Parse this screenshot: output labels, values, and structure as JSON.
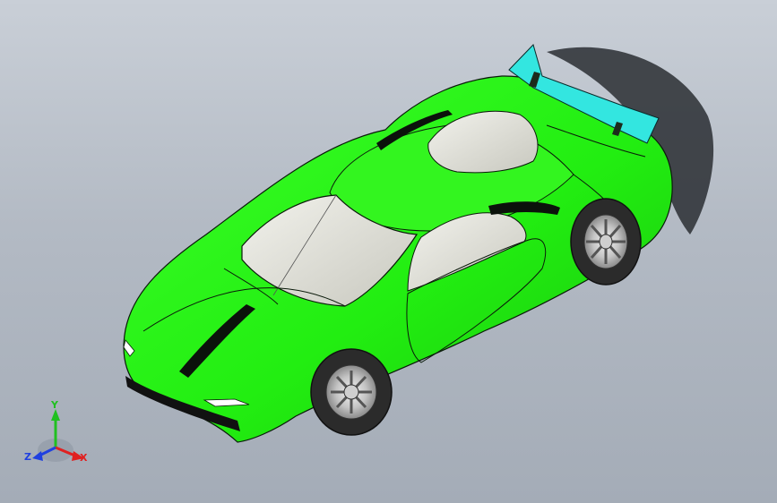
{
  "viewport": {
    "background_top": "#c9cfd7",
    "background_bottom": "#a4acb7"
  },
  "model": {
    "body_color": "#22ee11",
    "wing_color": "#33e6e0",
    "glass_color": "#dcdcd4",
    "tire_color": "#333333"
  },
  "triad": {
    "x_label": "X",
    "y_label": "Y",
    "z_label": "Z",
    "x_color": "#e02020",
    "y_color": "#20c020",
    "z_color": "#2040e0"
  }
}
